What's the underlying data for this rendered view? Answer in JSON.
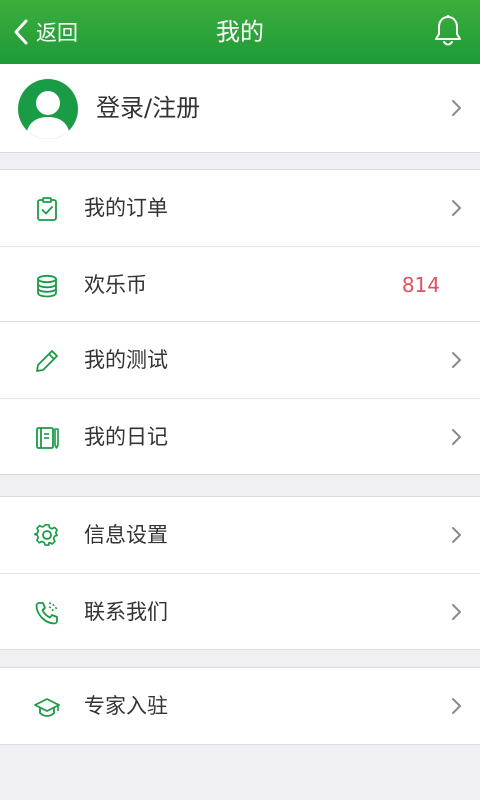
{
  "header": {
    "back_label": "返回",
    "title": "我的",
    "bell_icon": "bell-icon"
  },
  "profile": {
    "login_label": "登录/注册",
    "avatar_icon": "user-avatar-icon"
  },
  "groups": [
    {
      "items": [
        {
          "label": "我的订单",
          "icon": "clipboard-check-icon"
        },
        {
          "label": "欢乐币",
          "icon": "coin-stack-icon",
          "value": "814"
        }
      ]
    },
    {
      "items": [
        {
          "label": "我的测试",
          "icon": "pencil-icon"
        },
        {
          "label": "我的日记",
          "icon": "diary-icon"
        }
      ]
    },
    {
      "items": [
        {
          "label": "信息设置",
          "icon": "gear-icon"
        },
        {
          "label": "联系我们",
          "icon": "phone-icon"
        }
      ]
    },
    {
      "items": [
        {
          "label": "专家入驻",
          "icon": "graduation-cap-icon"
        }
      ]
    }
  ],
  "colors": {
    "header_green": "#2aa33a",
    "icon_green": "#1a9b45",
    "value_red": "#e4505d"
  }
}
